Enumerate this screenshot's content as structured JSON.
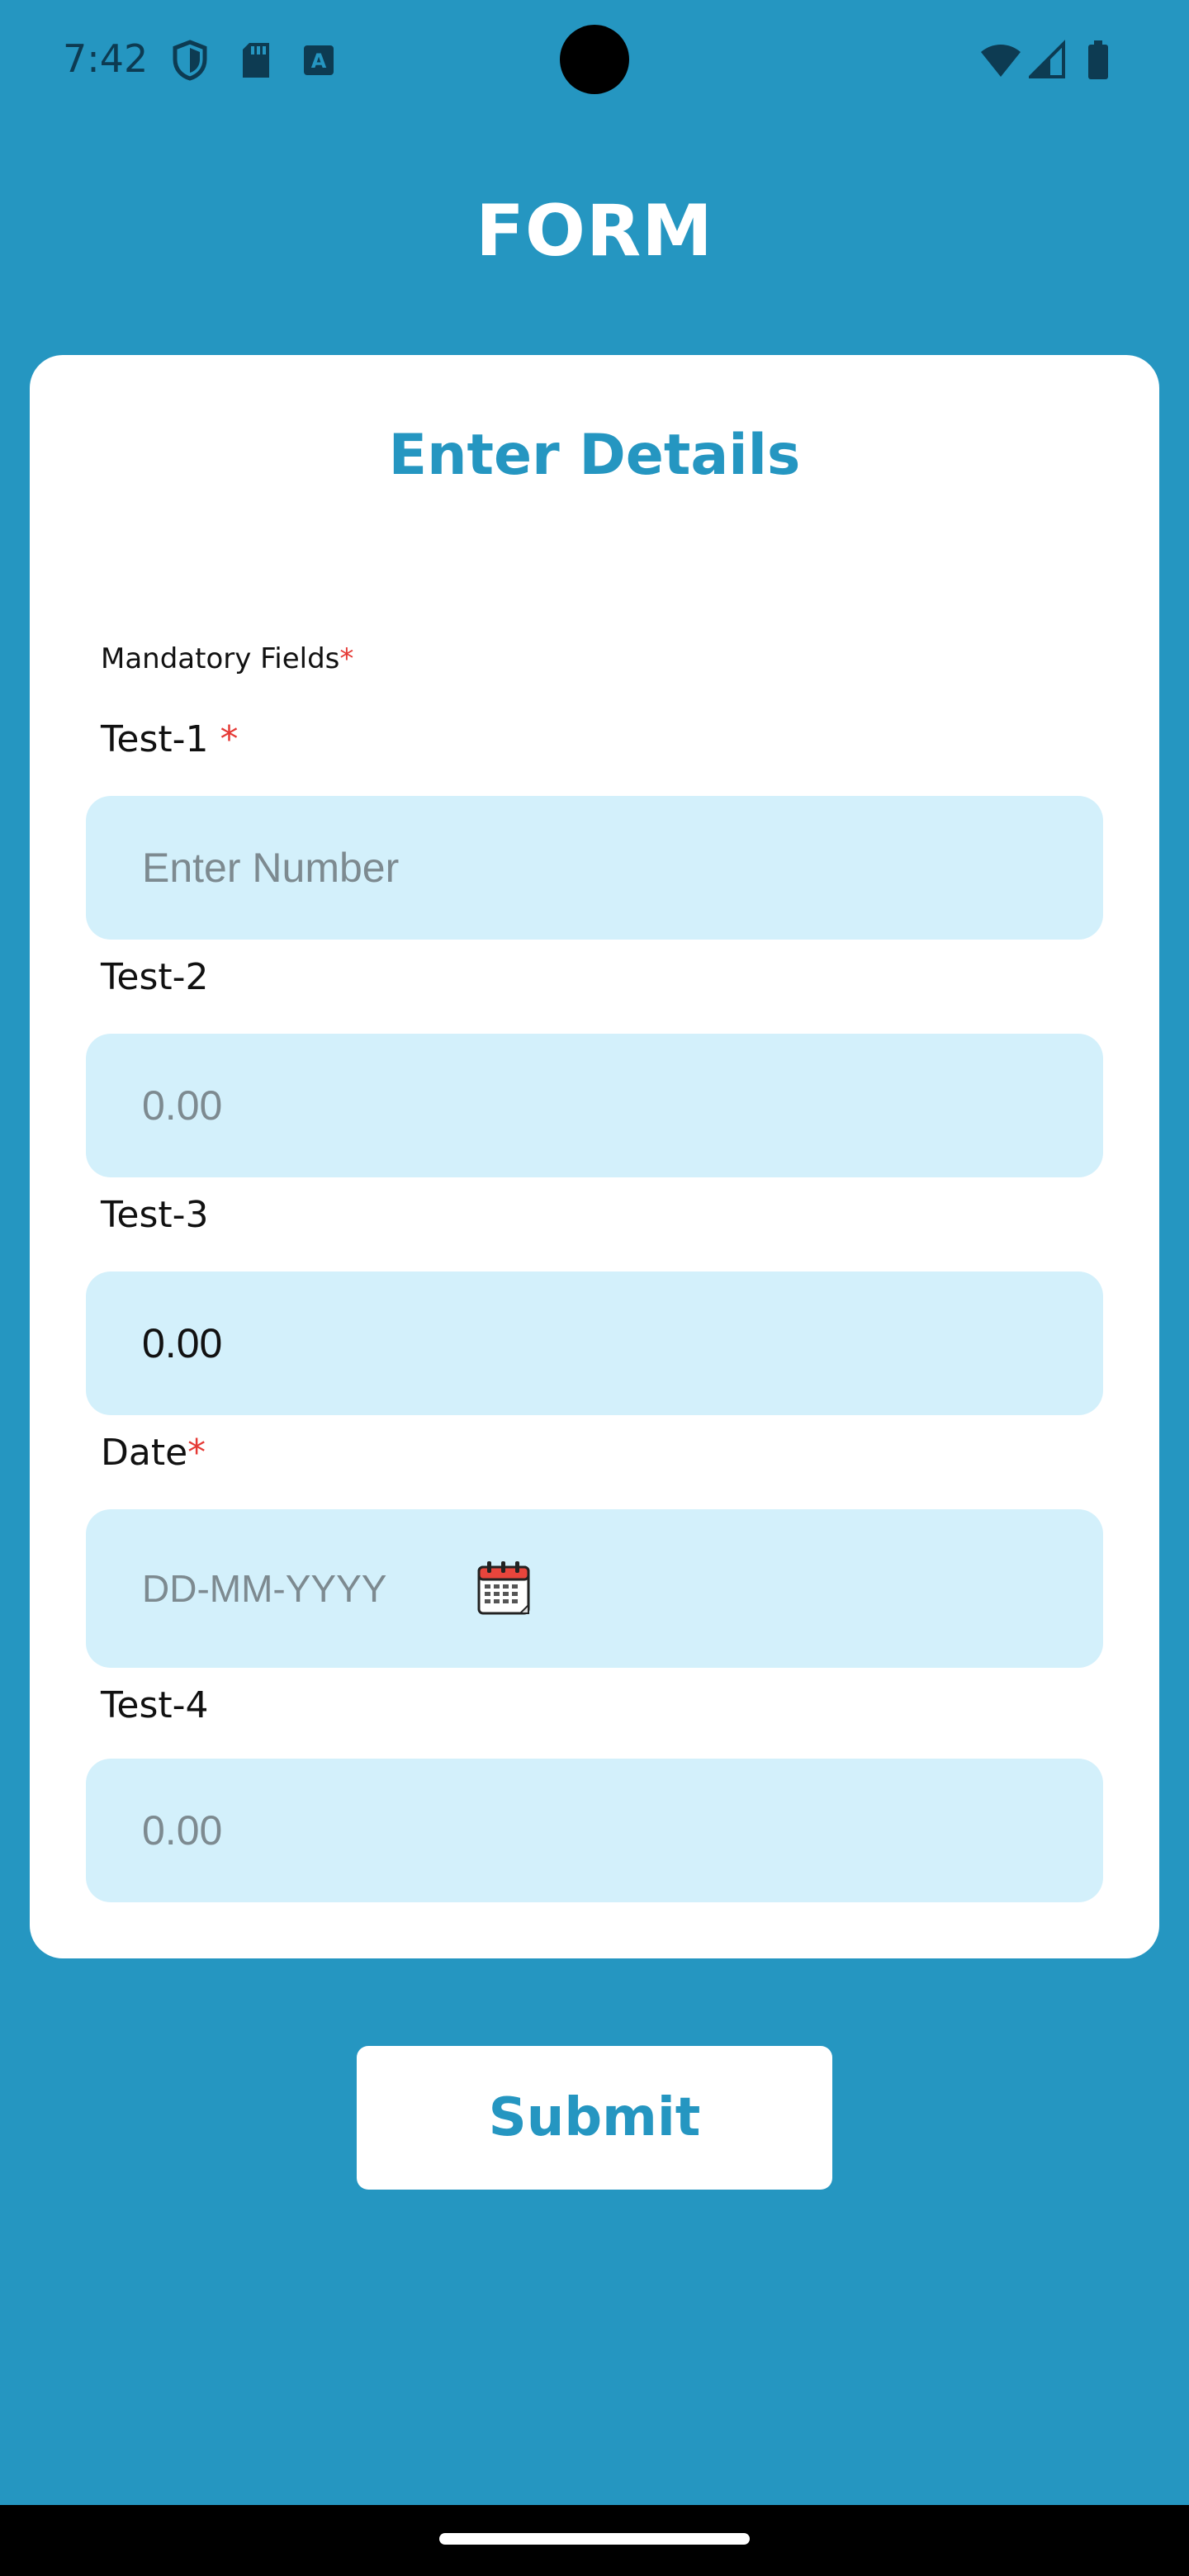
{
  "status_bar": {
    "time": "7:42",
    "left_icons": [
      "shield-icon",
      "sd-card-icon",
      "keyboard-a-icon"
    ],
    "right_icons": [
      "wifi-icon",
      "cell-signal-icon",
      "battery-icon"
    ]
  },
  "header": {
    "title": "FORM"
  },
  "card": {
    "title": "Enter Details",
    "mandatory_note": "Mandatory Fields",
    "required_mark": "*"
  },
  "fields": [
    {
      "label": "Test-1",
      "required": true,
      "placeholder": "Enter Number",
      "value": ""
    },
    {
      "label": "Test-2",
      "required": false,
      "placeholder": "0.00",
      "value": ""
    },
    {
      "label": "Test-3",
      "required": false,
      "placeholder": "",
      "value": "0.00"
    },
    {
      "label": "Date",
      "required": true,
      "placeholder": "DD-MM-YYYY",
      "value": "",
      "icon": "calendar-icon"
    },
    {
      "label": "Test-4",
      "required": false,
      "placeholder": "0.00",
      "value": ""
    }
  ],
  "actions": {
    "submit_label": "Submit"
  },
  "colors": {
    "background": "#2596c1",
    "card": "#ffffff",
    "field": "#d3f0fb",
    "required": "#e53935",
    "accent": "#2596c1"
  }
}
